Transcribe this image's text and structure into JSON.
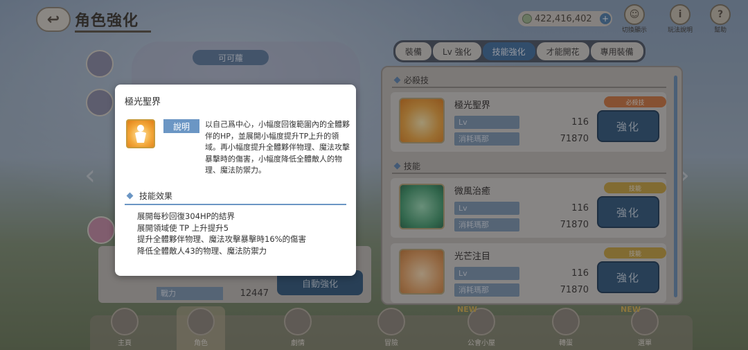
{
  "header": {
    "title": "角色強化",
    "currency": "422,416,402",
    "top_buttons": [
      {
        "label": "切換顯示",
        "icon": "character-switch-icon"
      },
      {
        "label": "玩法說明",
        "icon": "info-icon"
      },
      {
        "label": "幫助",
        "icon": "help-icon"
      }
    ]
  },
  "tabs": [
    {
      "label": "裝備",
      "active": false
    },
    {
      "label": "Lv 強化",
      "active": false
    },
    {
      "label": "技能強化",
      "active": true
    },
    {
      "label": "才能開花",
      "active": false
    },
    {
      "label": "專用裝備",
      "active": false
    }
  ],
  "character": {
    "name": "可可蘿"
  },
  "skill_panel": {
    "ub_section": "必殺技",
    "skill_section": "技能",
    "lv_label": "Lv",
    "cost_label": "消耗瑪那",
    "strengthen_label": "強化",
    "skills": [
      {
        "name": "極光聖界",
        "tag": "必殺技",
        "tag_color": "#d0763a",
        "lv": "116",
        "cost": "71870"
      },
      {
        "name": "微風治癒",
        "tag": "技能",
        "tag_color": "#c9a33a",
        "lv": "116",
        "cost": "71870"
      },
      {
        "name": "光芒注目",
        "tag": "技能",
        "tag_color": "#c9a33a",
        "lv": "116",
        "cost": "71870"
      }
    ]
  },
  "left_card": {
    "auto_label": "自動強化",
    "power_label": "戰力",
    "power_value": "12447"
  },
  "popup": {
    "title": "極光聖界",
    "desc_tag": "說明",
    "description": "以自己爲中心，小幅度回復範圍內的全體夥伴的HP，並展開小幅度提升TP上升的領域。再小幅度提升全體夥伴物理、魔法攻擊暴擊時的傷害，小幅度降低全體敵人的物理、魔法防禦力。",
    "effect_title": "技能效果",
    "effects": [
      "展開每秒回復304HP的結界",
      "展開領域使 TP 上升提升5",
      "提升全體夥伴物理、魔法攻擊暴擊時16%的傷害",
      "降低全體敵人43的物理、魔法防禦力"
    ]
  },
  "bottom_nav": [
    {
      "label": "主頁",
      "active": false
    },
    {
      "label": "角色",
      "active": true
    },
    {
      "label": "劇情",
      "active": false
    },
    {
      "label": "冒險",
      "active": false,
      "new": false
    },
    {
      "label": "公會小屋",
      "active": false,
      "new": true
    },
    {
      "label": "轉蛋",
      "active": false
    },
    {
      "label": "選單",
      "active": false,
      "new": true
    }
  ],
  "new_badge": "NEW"
}
